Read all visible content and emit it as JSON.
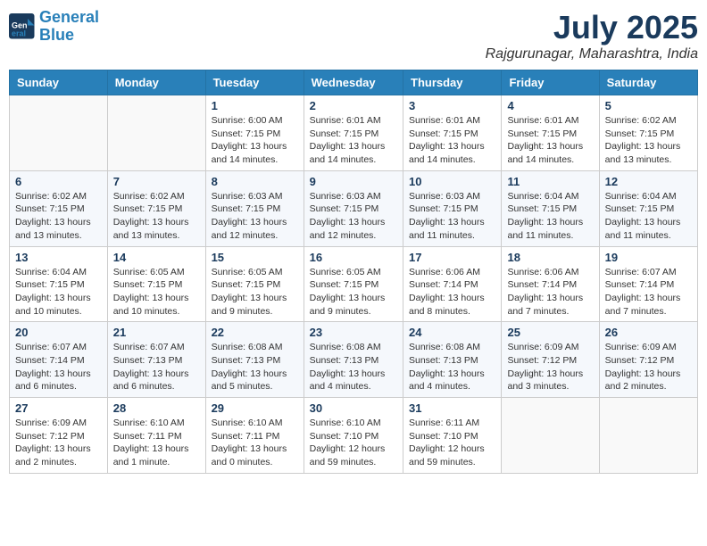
{
  "header": {
    "logo_line1": "General",
    "logo_line2": "Blue",
    "month_title": "July 2025",
    "location": "Rajgurunagar, Maharashtra, India"
  },
  "columns": [
    "Sunday",
    "Monday",
    "Tuesday",
    "Wednesday",
    "Thursday",
    "Friday",
    "Saturday"
  ],
  "weeks": [
    [
      {
        "day": "",
        "info": ""
      },
      {
        "day": "",
        "info": ""
      },
      {
        "day": "1",
        "info": "Sunrise: 6:00 AM\nSunset: 7:15 PM\nDaylight: 13 hours\nand 14 minutes."
      },
      {
        "day": "2",
        "info": "Sunrise: 6:01 AM\nSunset: 7:15 PM\nDaylight: 13 hours\nand 14 minutes."
      },
      {
        "day": "3",
        "info": "Sunrise: 6:01 AM\nSunset: 7:15 PM\nDaylight: 13 hours\nand 14 minutes."
      },
      {
        "day": "4",
        "info": "Sunrise: 6:01 AM\nSunset: 7:15 PM\nDaylight: 13 hours\nand 14 minutes."
      },
      {
        "day": "5",
        "info": "Sunrise: 6:02 AM\nSunset: 7:15 PM\nDaylight: 13 hours\nand 13 minutes."
      }
    ],
    [
      {
        "day": "6",
        "info": "Sunrise: 6:02 AM\nSunset: 7:15 PM\nDaylight: 13 hours\nand 13 minutes."
      },
      {
        "day": "7",
        "info": "Sunrise: 6:02 AM\nSunset: 7:15 PM\nDaylight: 13 hours\nand 13 minutes."
      },
      {
        "day": "8",
        "info": "Sunrise: 6:03 AM\nSunset: 7:15 PM\nDaylight: 13 hours\nand 12 minutes."
      },
      {
        "day": "9",
        "info": "Sunrise: 6:03 AM\nSunset: 7:15 PM\nDaylight: 13 hours\nand 12 minutes."
      },
      {
        "day": "10",
        "info": "Sunrise: 6:03 AM\nSunset: 7:15 PM\nDaylight: 13 hours\nand 11 minutes."
      },
      {
        "day": "11",
        "info": "Sunrise: 6:04 AM\nSunset: 7:15 PM\nDaylight: 13 hours\nand 11 minutes."
      },
      {
        "day": "12",
        "info": "Sunrise: 6:04 AM\nSunset: 7:15 PM\nDaylight: 13 hours\nand 11 minutes."
      }
    ],
    [
      {
        "day": "13",
        "info": "Sunrise: 6:04 AM\nSunset: 7:15 PM\nDaylight: 13 hours\nand 10 minutes."
      },
      {
        "day": "14",
        "info": "Sunrise: 6:05 AM\nSunset: 7:15 PM\nDaylight: 13 hours\nand 10 minutes."
      },
      {
        "day": "15",
        "info": "Sunrise: 6:05 AM\nSunset: 7:15 PM\nDaylight: 13 hours\nand 9 minutes."
      },
      {
        "day": "16",
        "info": "Sunrise: 6:05 AM\nSunset: 7:15 PM\nDaylight: 13 hours\nand 9 minutes."
      },
      {
        "day": "17",
        "info": "Sunrise: 6:06 AM\nSunset: 7:14 PM\nDaylight: 13 hours\nand 8 minutes."
      },
      {
        "day": "18",
        "info": "Sunrise: 6:06 AM\nSunset: 7:14 PM\nDaylight: 13 hours\nand 7 minutes."
      },
      {
        "day": "19",
        "info": "Sunrise: 6:07 AM\nSunset: 7:14 PM\nDaylight: 13 hours\nand 7 minutes."
      }
    ],
    [
      {
        "day": "20",
        "info": "Sunrise: 6:07 AM\nSunset: 7:14 PM\nDaylight: 13 hours\nand 6 minutes."
      },
      {
        "day": "21",
        "info": "Sunrise: 6:07 AM\nSunset: 7:13 PM\nDaylight: 13 hours\nand 6 minutes."
      },
      {
        "day": "22",
        "info": "Sunrise: 6:08 AM\nSunset: 7:13 PM\nDaylight: 13 hours\nand 5 minutes."
      },
      {
        "day": "23",
        "info": "Sunrise: 6:08 AM\nSunset: 7:13 PM\nDaylight: 13 hours\nand 4 minutes."
      },
      {
        "day": "24",
        "info": "Sunrise: 6:08 AM\nSunset: 7:13 PM\nDaylight: 13 hours\nand 4 minutes."
      },
      {
        "day": "25",
        "info": "Sunrise: 6:09 AM\nSunset: 7:12 PM\nDaylight: 13 hours\nand 3 minutes."
      },
      {
        "day": "26",
        "info": "Sunrise: 6:09 AM\nSunset: 7:12 PM\nDaylight: 13 hours\nand 2 minutes."
      }
    ],
    [
      {
        "day": "27",
        "info": "Sunrise: 6:09 AM\nSunset: 7:12 PM\nDaylight: 13 hours\nand 2 minutes."
      },
      {
        "day": "28",
        "info": "Sunrise: 6:10 AM\nSunset: 7:11 PM\nDaylight: 13 hours\nand 1 minute."
      },
      {
        "day": "29",
        "info": "Sunrise: 6:10 AM\nSunset: 7:11 PM\nDaylight: 13 hours\nand 0 minutes."
      },
      {
        "day": "30",
        "info": "Sunrise: 6:10 AM\nSunset: 7:10 PM\nDaylight: 12 hours\nand 59 minutes."
      },
      {
        "day": "31",
        "info": "Sunrise: 6:11 AM\nSunset: 7:10 PM\nDaylight: 12 hours\nand 59 minutes."
      },
      {
        "day": "",
        "info": ""
      },
      {
        "day": "",
        "info": ""
      }
    ]
  ]
}
